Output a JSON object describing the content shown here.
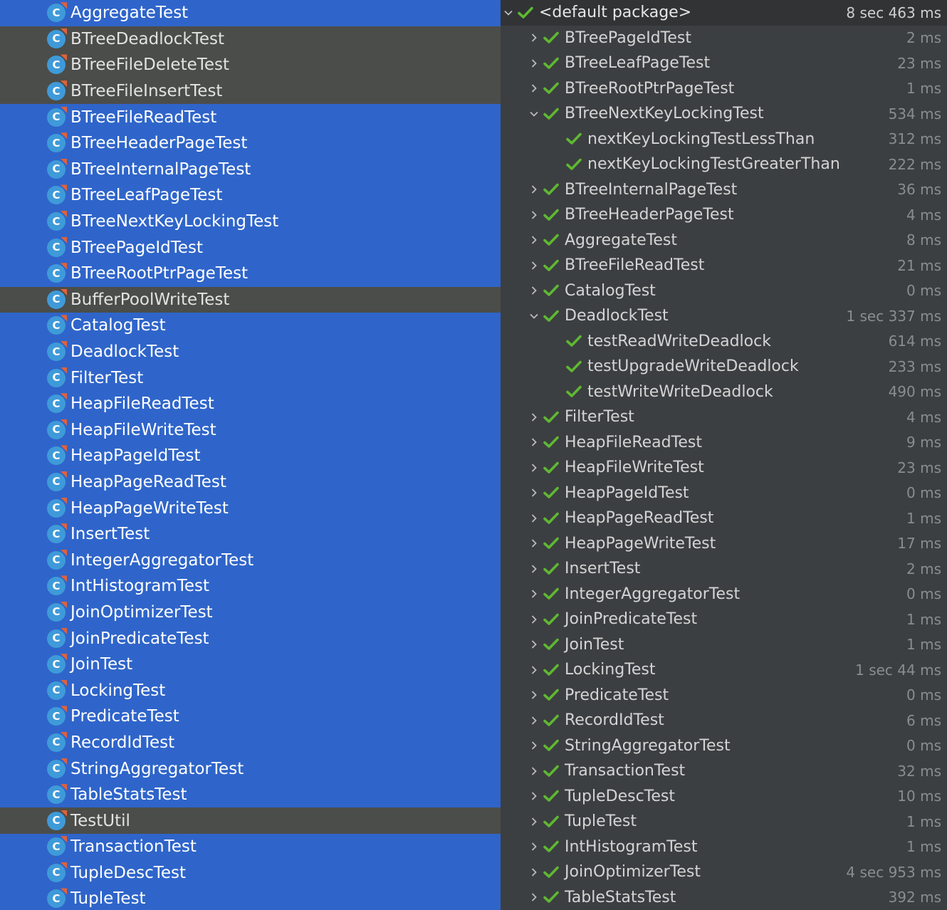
{
  "project_tree": {
    "items": [
      {
        "label": "AggregateTest",
        "selected": true
      },
      {
        "label": "BTreeDeadlockTest",
        "selected": false
      },
      {
        "label": "BTreeFileDeleteTest",
        "selected": false
      },
      {
        "label": "BTreeFileInsertTest",
        "selected": false
      },
      {
        "label": "BTreeFileReadTest",
        "selected": true
      },
      {
        "label": "BTreeHeaderPageTest",
        "selected": true
      },
      {
        "label": "BTreeInternalPageTest",
        "selected": true
      },
      {
        "label": "BTreeLeafPageTest",
        "selected": true
      },
      {
        "label": "BTreeNextKeyLockingTest",
        "selected": true
      },
      {
        "label": "BTreePageIdTest",
        "selected": true
      },
      {
        "label": "BTreeRootPtrPageTest",
        "selected": true
      },
      {
        "label": "BufferPoolWriteTest",
        "selected": false
      },
      {
        "label": "CatalogTest",
        "selected": true
      },
      {
        "label": "DeadlockTest",
        "selected": true
      },
      {
        "label": "FilterTest",
        "selected": true
      },
      {
        "label": "HeapFileReadTest",
        "selected": true
      },
      {
        "label": "HeapFileWriteTest",
        "selected": true
      },
      {
        "label": "HeapPageIdTest",
        "selected": true
      },
      {
        "label": "HeapPageReadTest",
        "selected": true
      },
      {
        "label": "HeapPageWriteTest",
        "selected": true
      },
      {
        "label": "InsertTest",
        "selected": true
      },
      {
        "label": "IntegerAggregatorTest",
        "selected": true
      },
      {
        "label": "IntHistogramTest",
        "selected": true
      },
      {
        "label": "JoinOptimizerTest",
        "selected": true
      },
      {
        "label": "JoinPredicateTest",
        "selected": true
      },
      {
        "label": "JoinTest",
        "selected": true
      },
      {
        "label": "LockingTest",
        "selected": true
      },
      {
        "label": "PredicateTest",
        "selected": true
      },
      {
        "label": "RecordIdTest",
        "selected": true
      },
      {
        "label": "StringAggregatorTest",
        "selected": true
      },
      {
        "label": "TableStatsTest",
        "selected": true
      },
      {
        "label": "TestUtil",
        "selected": false
      },
      {
        "label": "TransactionTest",
        "selected": true
      },
      {
        "label": "TupleDescTest",
        "selected": true
      },
      {
        "label": "TupleTest",
        "selected": true
      }
    ]
  },
  "test_results": {
    "root": {
      "label": "<default package>",
      "time": "8 sec 463 ms",
      "expanded": true
    },
    "items": [
      {
        "label": "BTreePageIdTest",
        "time": "2 ms",
        "level": 1,
        "expanded": false
      },
      {
        "label": "BTreeLeafPageTest",
        "time": "23 ms",
        "level": 1,
        "expanded": false
      },
      {
        "label": "BTreeRootPtrPageTest",
        "time": "1 ms",
        "level": 1,
        "expanded": false
      },
      {
        "label": "BTreeNextKeyLockingTest",
        "time": "534 ms",
        "level": 1,
        "expanded": true
      },
      {
        "label": "nextKeyLockingTestLessThan",
        "time": "312 ms",
        "level": 2
      },
      {
        "label": "nextKeyLockingTestGreaterThan",
        "time": "222 ms",
        "level": 2
      },
      {
        "label": "BTreeInternalPageTest",
        "time": "36 ms",
        "level": 1,
        "expanded": false
      },
      {
        "label": "BTreeHeaderPageTest",
        "time": "4 ms",
        "level": 1,
        "expanded": false
      },
      {
        "label": "AggregateTest",
        "time": "8 ms",
        "level": 1,
        "expanded": false
      },
      {
        "label": "BTreeFileReadTest",
        "time": "21 ms",
        "level": 1,
        "expanded": false
      },
      {
        "label": "CatalogTest",
        "time": "0 ms",
        "level": 1,
        "expanded": false
      },
      {
        "label": "DeadlockTest",
        "time": "1 sec 337 ms",
        "level": 1,
        "expanded": true
      },
      {
        "label": "testReadWriteDeadlock",
        "time": "614 ms",
        "level": 2
      },
      {
        "label": "testUpgradeWriteDeadlock",
        "time": "233 ms",
        "level": 2
      },
      {
        "label": "testWriteWriteDeadlock",
        "time": "490 ms",
        "level": 2
      },
      {
        "label": "FilterTest",
        "time": "4 ms",
        "level": 1,
        "expanded": false
      },
      {
        "label": "HeapFileReadTest",
        "time": "9 ms",
        "level": 1,
        "expanded": false
      },
      {
        "label": "HeapFileWriteTest",
        "time": "23 ms",
        "level": 1,
        "expanded": false
      },
      {
        "label": "HeapPageIdTest",
        "time": "0 ms",
        "level": 1,
        "expanded": false
      },
      {
        "label": "HeapPageReadTest",
        "time": "1 ms",
        "level": 1,
        "expanded": false
      },
      {
        "label": "HeapPageWriteTest",
        "time": "17 ms",
        "level": 1,
        "expanded": false
      },
      {
        "label": "InsertTest",
        "time": "2 ms",
        "level": 1,
        "expanded": false
      },
      {
        "label": "IntegerAggregatorTest",
        "time": "0 ms",
        "level": 1,
        "expanded": false
      },
      {
        "label": "JoinPredicateTest",
        "time": "1 ms",
        "level": 1,
        "expanded": false
      },
      {
        "label": "JoinTest",
        "time": "1 ms",
        "level": 1,
        "expanded": false
      },
      {
        "label": "LockingTest",
        "time": "1 sec 44 ms",
        "level": 1,
        "expanded": false
      },
      {
        "label": "PredicateTest",
        "time": "0 ms",
        "level": 1,
        "expanded": false
      },
      {
        "label": "RecordIdTest",
        "time": "6 ms",
        "level": 1,
        "expanded": false
      },
      {
        "label": "StringAggregatorTest",
        "time": "0 ms",
        "level": 1,
        "expanded": false
      },
      {
        "label": "TransactionTest",
        "time": "32 ms",
        "level": 1,
        "expanded": false
      },
      {
        "label": "TupleDescTest",
        "time": "10 ms",
        "level": 1,
        "expanded": false
      },
      {
        "label": "TupleTest",
        "time": "1 ms",
        "level": 1,
        "expanded": false
      },
      {
        "label": "IntHistogramTest",
        "time": "1 ms",
        "level": 1,
        "expanded": false
      },
      {
        "label": "JoinOptimizerTest",
        "time": "4 sec 953 ms",
        "level": 1,
        "expanded": false
      },
      {
        "label": "TableStatsTest",
        "time": "392 ms",
        "level": 1,
        "expanded": false
      }
    ]
  },
  "colors": {
    "selection": "#2f65ca",
    "unselected_row": "#4b4d4a",
    "panel": "#3c3f41",
    "pass_check": "#5fb832",
    "class_icon": "#3f9ad9"
  },
  "icons": {
    "class": "java-class-icon",
    "pass": "check-icon",
    "collapsed": "chevron-right-icon",
    "expanded": "chevron-down-icon"
  }
}
